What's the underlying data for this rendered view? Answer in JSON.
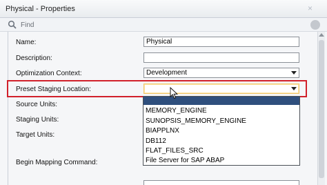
{
  "window": {
    "title": "Physical - Properties",
    "close_glyph": "×"
  },
  "find": {
    "placeholder": "Find"
  },
  "properties": {
    "name_label": "Name:",
    "name_value": "Physical",
    "description_label": "Description:",
    "description_value": "",
    "optimization_context_label": "Optimization Context:",
    "optimization_context_value": "Development",
    "preset_staging_label": "Preset Staging Location:",
    "preset_staging_value": "",
    "source_units_label": "Source Units:",
    "staging_units_label": "Staging Units:",
    "target_units_label": "Target Units:",
    "begin_mapping_label": "Begin Mapping Command:"
  },
  "dropdown": {
    "options": [
      "",
      "MEMORY_ENGINE",
      "SUNOPSIS_MEMORY_ENGINE",
      "BIAPPLNX",
      "DB112",
      "FLAT_FILES_SRC",
      "File Server for SAP ABAP"
    ],
    "selected_index": 0
  },
  "colors": {
    "highlight_border": "#d1202a",
    "selected_option": "#2f4f7d"
  }
}
